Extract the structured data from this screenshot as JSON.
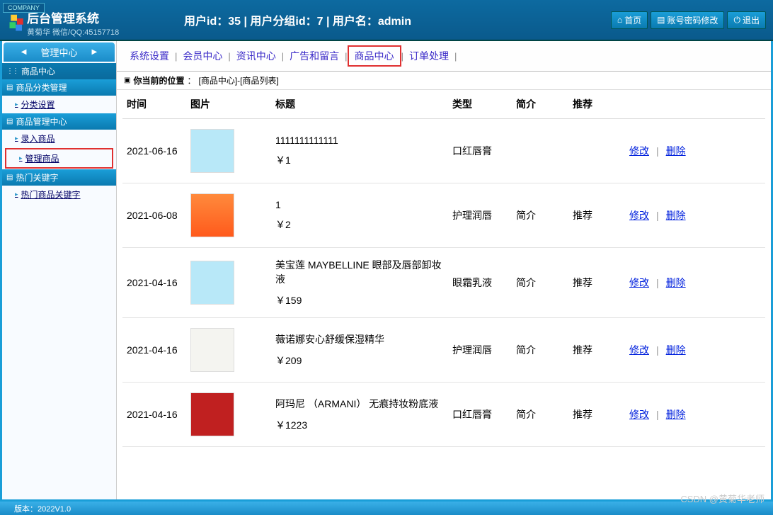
{
  "company_tag": "COMPANY",
  "header": {
    "title": "后台管理系统",
    "subtitle": "黄菊华 微信/QQ:45157718",
    "user_info": "用户id：35 | 用户分组id：7 | 用户名：admin",
    "buttons": {
      "home": "首页",
      "pwd": "账号密码修改",
      "logout": "退出"
    }
  },
  "sidebar": {
    "title": "管理中心",
    "center_label": "商品中心",
    "sections": [
      {
        "header": "商品分类管理",
        "links": [
          {
            "label": "分类设置",
            "boxed": false
          }
        ]
      },
      {
        "header": "商品管理中心",
        "links": [
          {
            "label": "录入商品",
            "boxed": false
          },
          {
            "label": "管理商品",
            "boxed": true
          }
        ]
      },
      {
        "header": "热门关键字",
        "links": [
          {
            "label": "热门商品关键字",
            "boxed": false
          }
        ]
      }
    ]
  },
  "tabs": [
    {
      "label": "系统设置",
      "boxed": false
    },
    {
      "label": "会员中心",
      "boxed": false
    },
    {
      "label": "资讯中心",
      "boxed": false
    },
    {
      "label": "广告和留言",
      "boxed": false
    },
    {
      "label": "商品中心",
      "boxed": true
    },
    {
      "label": "订单处理",
      "boxed": false
    }
  ],
  "breadcrumb": {
    "prefix": "你当前的位置",
    "path": "[商品中心]-[商品列表]"
  },
  "table": {
    "headers": {
      "time": "时间",
      "img": "图片",
      "title": "标题",
      "type": "类型",
      "intro": "简介",
      "rec": "推荐",
      "ops": ""
    },
    "action_edit": "修改",
    "action_del": "删除",
    "rows": [
      {
        "time": "2021-06-16",
        "thumb": "t-blue",
        "title": "1111111111111",
        "price": "￥1",
        "type": "口红唇膏",
        "intro": "",
        "rec": ""
      },
      {
        "time": "2021-06-08",
        "thumb": "t-orange",
        "title": "1",
        "price": "￥2",
        "type": "护理润唇",
        "intro": "简介",
        "rec": "推荐"
      },
      {
        "time": "2021-04-16",
        "thumb": "t-blue",
        "title": "美宝莲 MAYBELLINE 眼部及唇部卸妆液",
        "price": "￥159",
        "type": "眼霜乳液",
        "intro": "简介",
        "rec": "推荐"
      },
      {
        "time": "2021-04-16",
        "thumb": "t-white",
        "title": "薇诺娜安心舒缓保湿精华",
        "price": "￥209",
        "type": "护理润唇",
        "intro": "简介",
        "rec": "推荐"
      },
      {
        "time": "2021-04-16",
        "thumb": "t-red",
        "title": "阿玛尼 （ARMANI） 无痕持妆粉底液",
        "price": "￥1223",
        "type": "口红唇膏",
        "intro": "简介",
        "rec": "推荐"
      }
    ]
  },
  "footer": "版本：2022V1.0",
  "watermark": "CSDN @黄菊华老师"
}
